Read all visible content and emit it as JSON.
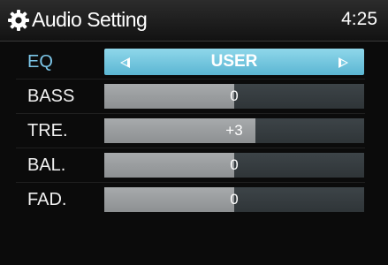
{
  "header": {
    "title": "Audio Setting",
    "time": "4:25",
    "icon": "gear-icon"
  },
  "eq": {
    "label": "EQ",
    "value": "USER",
    "label_color": "#7cc6e8",
    "highlight_color": "#6cc3dd"
  },
  "sliders": [
    {
      "key": "bass",
      "label": "BASS",
      "display": "0",
      "level": 0.5
    },
    {
      "key": "treble",
      "label": "TRE.",
      "display": "+3",
      "level": 0.58
    },
    {
      "key": "balance",
      "label": "BAL.",
      "display": "0",
      "level": 0.5
    },
    {
      "key": "fader",
      "label": "FAD.",
      "display": "0",
      "level": 0.5
    }
  ]
}
